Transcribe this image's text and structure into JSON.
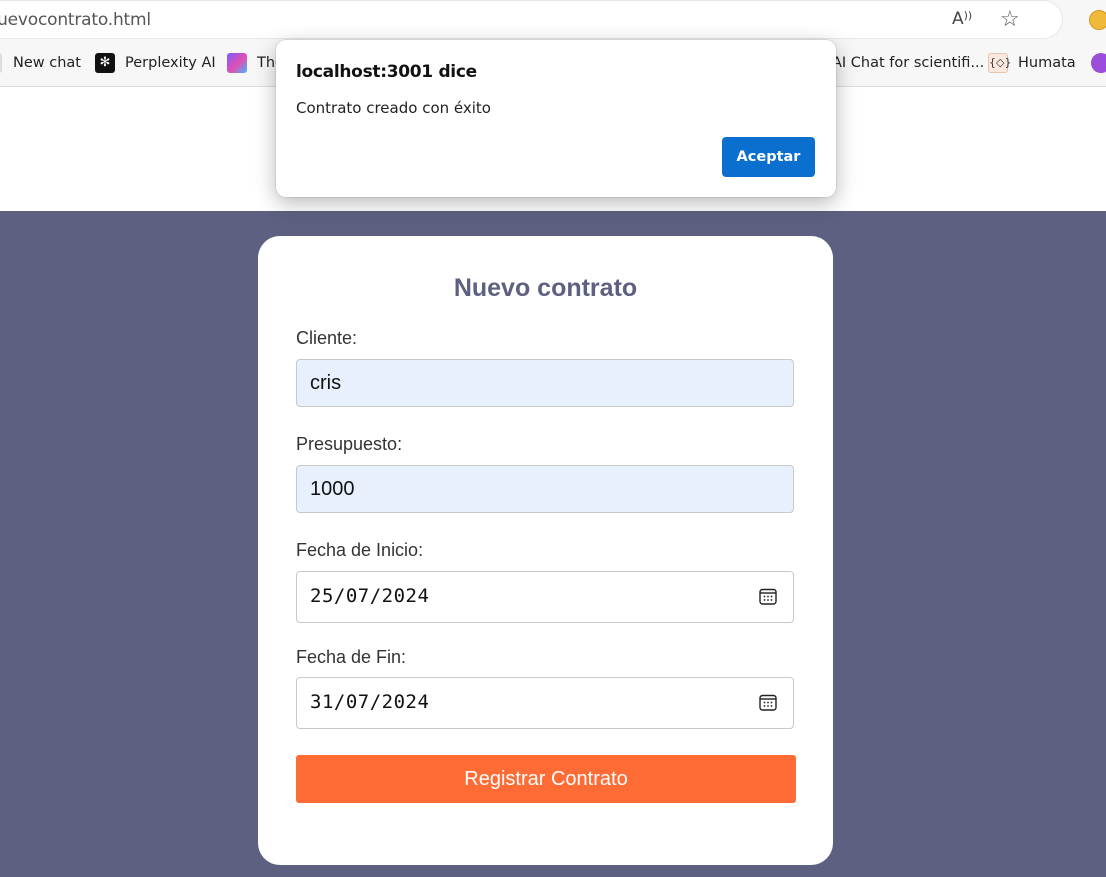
{
  "browser": {
    "url": "/nuevocontrato.html",
    "bookmarks": [
      {
        "label": "New chat"
      },
      {
        "label": "Perplexity AI"
      },
      {
        "label": "The"
      },
      {
        "label": "AI Chat for scientifi..."
      },
      {
        "label": "Humata"
      }
    ]
  },
  "form": {
    "title": "Nuevo contrato",
    "cliente_label": "Cliente:",
    "cliente_value": "cris",
    "presupuesto_label": "Presupuesto:",
    "presupuesto_value": "1000",
    "fecha_inicio_label": "Fecha de Inicio:",
    "fecha_inicio_value": "25/07/2024",
    "fecha_fin_label": "Fecha de Fin:",
    "fecha_fin_value": "31/07/2024",
    "submit_label": "Registrar Contrato"
  },
  "dialog": {
    "title": "localhost:3001 dice",
    "message": "Contrato creado con éxito",
    "ok_label": "Aceptar"
  },
  "colors": {
    "page_background": "#5d6080",
    "submit_button": "#ff6b35",
    "dialog_button": "#0b6fd0",
    "autofill_field": "#e8f0fe"
  }
}
